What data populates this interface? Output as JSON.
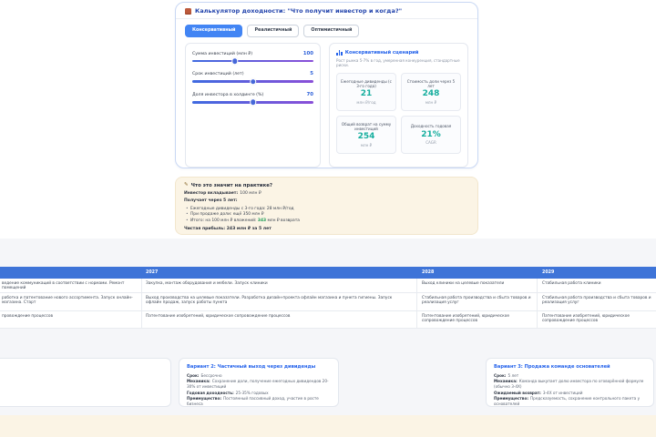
{
  "calculator": {
    "title": "Калькулятор доходности: \"Что получит инвестор и когда?\"",
    "tabs": [
      {
        "label": "Консервативный",
        "active": true
      },
      {
        "label": "Реалистичный",
        "active": false
      },
      {
        "label": "Оптимистичный",
        "active": false
      }
    ],
    "sliders": [
      {
        "label": "Сумма инвестиций (млн ₽)",
        "value": "100"
      },
      {
        "label": "Срок инвестиций (лет)",
        "value": "5"
      },
      {
        "label": "Доля инвестора в холдинге (%)",
        "value": "70"
      }
    ],
    "scenario": {
      "title": "Консервативный сценарий",
      "subtitle": "Рост рынка 5-7% в год, умеренная конкуренция, стандартные риски.",
      "metrics": [
        {
          "label": "Ежегодные дивиденды (с 3-го года)",
          "value": "21",
          "unit": "млн ₽/год"
        },
        {
          "label": "Стоимость доли через 5 лет",
          "value": "248",
          "unit": "млн ₽"
        },
        {
          "label": "Общий возврат на сумму инвестиций",
          "value": "254",
          "unit": "млн ₽"
        },
        {
          "label": "Доходность годовая",
          "value": "21%",
          "unit": "CAGR"
        }
      ]
    }
  },
  "practice": {
    "title": "Что это значит на практике?",
    "invest_label": "Инвестор вкладывает:",
    "invest_value": "100 млн ₽",
    "receive_label": "Получает через 5 лет:",
    "bullets": [
      {
        "pre": "Ежегодные дивиденды с 3-го года: 28 млн ₽/год",
        "highlight": "",
        "post": ""
      },
      {
        "pre": "При продаже доли: ещё 350 млн ₽",
        "highlight": "",
        "post": ""
      },
      {
        "pre": "Итого: на 100 млн ₽ вложений: ",
        "highlight": "343",
        "post": " млн ₽ возврата"
      }
    ],
    "net_label": "Чистая прибыль:",
    "net_value": "243 млн ₽ за 5 лет"
  },
  "roadmap": {
    "years": [
      "2027",
      "2028",
      "2029"
    ],
    "rows": [
      {
        "cols": [
          "ведение коммуникаций в соответствии с нормами. Ремонт помещений",
          "Закупка, монтаж оборудования и мебели. Запуск клиники",
          "Выход клиники на целевые показатели",
          "Стабильная работа клиники"
        ]
      },
      {
        "cols": [
          "работка и патентование нового ассортимента. Запуск онлайн-магазина. Старт",
          "Выход производства на целевые показатели. Разработка дизайн-проекта офлайн магазина и пункта гигиены. Запуск офлайн продаж, запуск работы пункта",
          "Стабильная работа производства и сбыта товаров и реализация услуг",
          "Стабильная работа производства и сбыта товаров и реализация услуг"
        ]
      },
      {
        "cols": [
          "провождение процессов",
          "Патентование изобретений, юридическое сопровождение процессов",
          "Патентование изобретений, юридическое сопровождение процессов",
          "Патентование изобретений, юридическое сопровождение процессов"
        ]
      }
    ]
  },
  "variants": [
    {
      "title": "Вариант 2: Частичный выход через дивиденды",
      "rows": [
        {
          "label": "Срок:",
          "text": "Бессрочно"
        },
        {
          "label": "Механика:",
          "text": "Сохранение доли, получение ежегодных дивидендов 20-30% от инвестиций"
        },
        {
          "label": "Годовая доходность:",
          "text": "25-35% годовых"
        },
        {
          "label": "Преимущество:",
          "text": "Постоянный пассивный доход, участие в росте бизнеса"
        }
      ]
    },
    {
      "title": "Вариант 3: Продажа команде основателей",
      "rows": [
        {
          "label": "Срок:",
          "text": "5 лет"
        },
        {
          "label": "Механика:",
          "text": "Команда выкупает долю инвестора по оговорённой формуле (обычно 3-4X)"
        },
        {
          "label": "Ожидаемый возврат:",
          "text": "3-4X от инвестиций"
        },
        {
          "label": "Преимущество:",
          "text": "Предсказуемость, сохранение контрольного пакета у основателей"
        }
      ]
    }
  ],
  "colors": {
    "accent_blue": "#2563eb",
    "tab_active": "#4285f4",
    "teal_value": "#16ae9e",
    "table_header": "#3e74d8",
    "beige": "#fbf4e5",
    "highlight_green": "#1e9e57"
  }
}
